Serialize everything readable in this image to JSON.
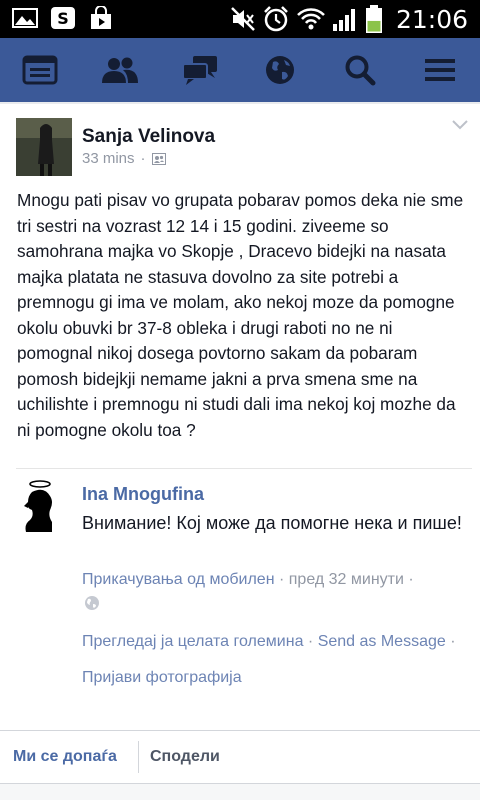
{
  "status_bar": {
    "time": "21:06",
    "left_icons": [
      "gallery-icon",
      "skype-icon",
      "shopping-bag-icon"
    ],
    "right_icons": [
      "mute-icon",
      "alarm-icon",
      "wifi-icon",
      "signal-icon",
      "battery-icon"
    ],
    "battery_level": 0.45
  },
  "nav": {
    "items": [
      "news-feed-icon",
      "friend-requests-icon",
      "messages-icon",
      "notifications-globe-icon",
      "search-icon",
      "menu-icon"
    ],
    "bar_color": "#3b5998"
  },
  "post": {
    "author": "Sanja Velinova",
    "time": "33 mins",
    "audience_icon": "friends-icon",
    "text": "Mnogu pati pisav vo grupata pobarav pomos deka nie sme tri sestri na vozrast 12 14 i 15 godini. ziveeme so samohrana majka vo Skopje , Dracevo bidejki na nasata majka platata ne stasuva dovolno za site potrebi a premnogu gi ima ve molam, ako nekoj moze da pomogne okolu obuvki br 37-8 obleka i drugi raboti no ne ni pomognal nikoj dosega povtorno sakam da pobaram pomosh bidejkji nemame jakni a prva smena sme na uchilishte i premnogu ni studi dali ima nekoj koj mozhe da ni pomogne okolu toa ?"
  },
  "comment": {
    "author": "Ina Mnogufina",
    "text": "Внимание! Кој може да помогне нека и пише!",
    "attachment_link": "Прикачувања од мобилен",
    "time_sep": " · ",
    "time": "пред 32 минути",
    "trailing_dot": " ·",
    "view_full": "Прегледај ја целата големина",
    "send_as": "Send as Message",
    "report": "Пријави фотографија",
    "dot": " · "
  },
  "bottom_bar": {
    "like_label": "Ми се допаѓа",
    "share_label": "Сподели"
  },
  "colors": {
    "brand": "#3b5998",
    "link": "#4b6aa5",
    "meta": "#9197a3"
  }
}
